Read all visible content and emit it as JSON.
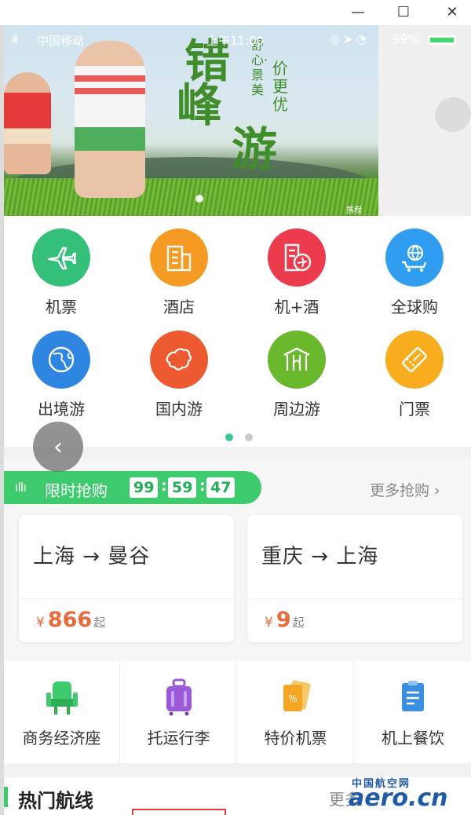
{
  "window": {
    "minimize": "—",
    "maximize": "☐",
    "close": "✕"
  },
  "status_bar": {
    "signal": "ıll",
    "carrier": "中国移动",
    "time": "上午11:00",
    "battery_pct": "99%"
  },
  "banner": {
    "title_chars": [
      "错",
      "峰",
      "游"
    ],
    "sub1": "舒心·景美",
    "sub2": "价更优",
    "logo": "携程"
  },
  "categories": [
    {
      "label": "机票",
      "icon": "plane-icon",
      "color": "#35c07a"
    },
    {
      "label": "酒店",
      "icon": "building-icon",
      "color": "#f59a22"
    },
    {
      "label": "机+酒",
      "icon": "plane-hotel-icon",
      "color": "#ec3b4d"
    },
    {
      "label": "全球购",
      "icon": "cart-globe-icon",
      "color": "#2f9ef0"
    },
    {
      "label": "出境游",
      "icon": "globe-icon",
      "color": "#2f86e0"
    },
    {
      "label": "国内游",
      "icon": "china-map-icon",
      "color": "#ee5a2f"
    },
    {
      "label": "周边游",
      "icon": "gate-icon",
      "color": "#6ab82c"
    },
    {
      "label": "门票",
      "icon": "ticket-icon",
      "color": "#f8ad1f"
    }
  ],
  "flash_sale": {
    "bars": "ıllı",
    "title": "限时抢购",
    "countdown": [
      "99",
      "59",
      "47"
    ],
    "more": "更多抢购 ›",
    "deals": [
      {
        "route": "上海 → 曼谷",
        "currency": "¥",
        "price": "866",
        "suffix": "起"
      },
      {
        "route": "重庆 → 上海",
        "currency": "¥",
        "price": "9",
        "suffix": "起"
      }
    ]
  },
  "services": [
    {
      "label": "商务经济座",
      "icon": "seat-icon",
      "color": "#3dcb6d"
    },
    {
      "label": "托运行李",
      "icon": "luggage-icon",
      "color": "#9b59d8"
    },
    {
      "label": "特价机票",
      "icon": "discount-ticket-icon",
      "color": "#f5a623"
    },
    {
      "label": "机上餐饮",
      "icon": "menu-icon",
      "color": "#3a8fe0"
    }
  ],
  "hot_routes": {
    "title": "热门航线",
    "more": "更多"
  },
  "back_button": "‹",
  "watermark": {
    "cn": "中国航空网",
    "en": "aero.cn"
  }
}
